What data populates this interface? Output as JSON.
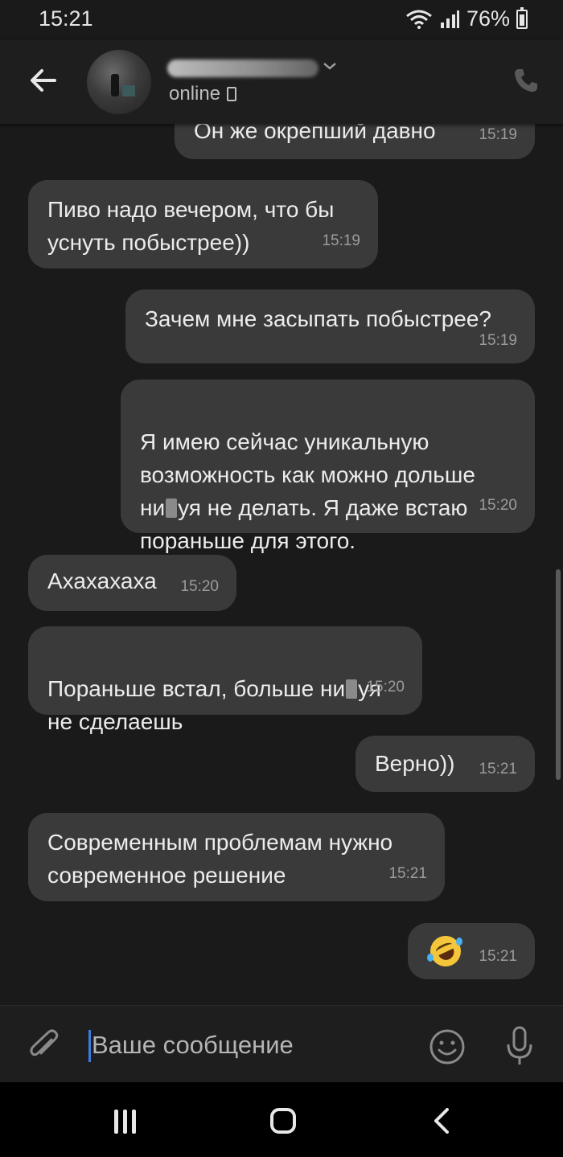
{
  "status_bar": {
    "time": "15:21",
    "battery": "76%"
  },
  "header": {
    "contact_status": "online"
  },
  "messages": [
    {
      "side": "out",
      "text": "Он же окрепший давно",
      "time": "15:19"
    },
    {
      "side": "in",
      "text": "Пиво надо вечером, что бы\nуснуть побыстрее))",
      "time": "15:19"
    },
    {
      "side": "out",
      "text": "Зачем мне засыпать побыстрее?",
      "time": "15:19"
    },
    {
      "side": "out",
      "text_parts": [
        "Я имею сейчас уникальную\nвозможность как можно дольше\nни",
        "уя не делать. Я даже встаю\nпораньше для этого."
      ],
      "time": "15:20"
    },
    {
      "side": "in",
      "text": "Ахахахаха",
      "time": "15:20"
    },
    {
      "side": "in",
      "text_parts": [
        "Пораньше встал, больше ни",
        "уя\nне сделаешь"
      ],
      "time": "15:20"
    },
    {
      "side": "out",
      "text": "Верно))",
      "time": "15:21"
    },
    {
      "side": "in",
      "text": "Современным проблемам нужно\nсовременное решение",
      "time": "15:21"
    },
    {
      "side": "out",
      "emoji": "rolling-on-the-floor-laughing",
      "time": "15:21"
    }
  ],
  "composer": {
    "placeholder": "Ваше сообщение"
  },
  "colors": {
    "background": "#1a1a1a",
    "bubble": "#3a3a3a",
    "accent_caret": "#3d7bdc"
  }
}
